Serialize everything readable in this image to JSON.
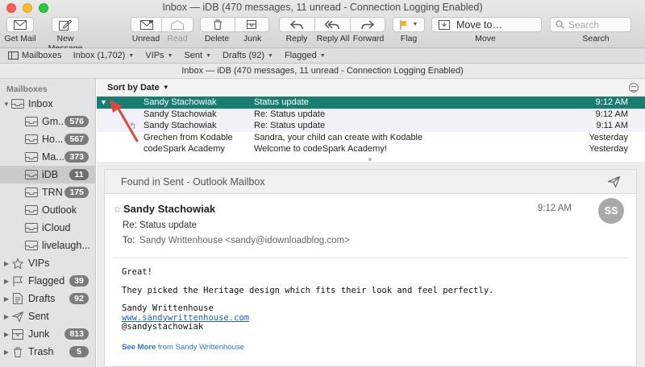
{
  "window": {
    "title": "Inbox — iDB (470 messages, 11 unread - Connection Logging Enabled)"
  },
  "toolbar": {
    "get_mail": "Get Mail",
    "new_message": "New Message",
    "unread": "Unread",
    "read": "Read",
    "delete": "Delete",
    "junk": "Junk",
    "reply": "Reply",
    "reply_all": "Reply All",
    "forward": "Forward",
    "flag": "Flag",
    "move_to": "Move to…",
    "move": "Move",
    "search_placeholder": "Search",
    "search": "Search"
  },
  "favorites": {
    "mailboxes": "Mailboxes",
    "inbox": "Inbox (1,702)",
    "vips": "VIPs",
    "sent": "Sent",
    "drafts": "Drafts (92)",
    "flagged": "Flagged"
  },
  "list_title": "Inbox — iDB (470 messages, 11 unread - Connection Logging Enabled)",
  "sidebar": {
    "header": "Mailboxes",
    "items": [
      {
        "label": "Inbox",
        "badge": ""
      },
      {
        "label": "Gm...",
        "badge": "576"
      },
      {
        "label": "Ho...",
        "badge": "567"
      },
      {
        "label": "Ma...",
        "badge": "373"
      },
      {
        "label": "iDB",
        "badge": "11"
      },
      {
        "label": "TRN",
        "badge": "175"
      },
      {
        "label": "Outlook",
        "badge": ""
      },
      {
        "label": "iCloud",
        "badge": ""
      },
      {
        "label": "livelaugh...",
        "badge": ""
      },
      {
        "label": "VIPs",
        "badge": ""
      },
      {
        "label": "Flagged",
        "badge": "39"
      },
      {
        "label": "Drafts",
        "badge": "92"
      },
      {
        "label": "Sent",
        "badge": ""
      },
      {
        "label": "Junk",
        "badge": "813"
      },
      {
        "label": "Trash",
        "badge": "5"
      }
    ]
  },
  "message_list": {
    "sort_label": "Sort by Date",
    "messages": [
      {
        "from": "Sandy Stachowiak",
        "subject": "Status update",
        "date": "9:12 AM"
      },
      {
        "from": "Sandy Stachowiak",
        "subject": "Re: Status update",
        "date": "9:12 AM"
      },
      {
        "from": "Sandy Stachowiak",
        "subject": "Re: Status update",
        "date": "9:11 AM"
      },
      {
        "from": "Grechen from Kodable",
        "subject": "Sandra, your child can create with Kodable",
        "date": "Yesterday"
      },
      {
        "from": "codeSpark Academy",
        "subject": "Welcome to codeSpark Academy!",
        "date": "Yesterday"
      }
    ]
  },
  "preview": {
    "found_in": "Found in Sent - Outlook Mailbox",
    "sender": "Sandy Stachowiak",
    "time": "9:12 AM",
    "avatar_initials": "SS",
    "subject": "Re: Status update",
    "to_label": "To:",
    "to_value": "Sandy Writtenhouse <sandy@idownloadblog.com>",
    "body": {
      "line1": "Great!",
      "line2": "They picked the Heritage design which fits their look and feel perfectly.",
      "sig_name": "Sandy Writtenhouse",
      "sig_link": "www.sandywrittenhouse.com",
      "sig_handle": "@sandystachowiak"
    },
    "see_more": "See More",
    "see_more_from": "from Sandy Writtenhouse"
  },
  "colors": {
    "selection": "#1a7d71",
    "annotation_arrow": "#e0463c",
    "link": "#1f5ec9"
  }
}
